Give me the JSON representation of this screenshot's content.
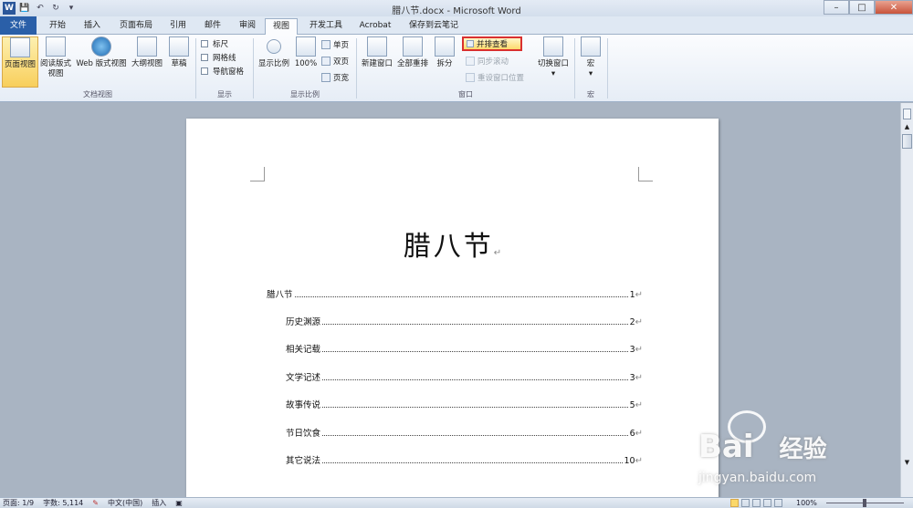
{
  "window": {
    "title": "腊八节.docx - Microsoft Word",
    "minimize": "–",
    "maximize": "□",
    "close": "✕"
  },
  "qat": {
    "save": "💾",
    "undo": "↶",
    "redo": "↻",
    "customize": "▾"
  },
  "tabs": [
    {
      "label": "文件"
    },
    {
      "label": "开始"
    },
    {
      "label": "插入"
    },
    {
      "label": "页面布局"
    },
    {
      "label": "引用"
    },
    {
      "label": "邮件"
    },
    {
      "label": "审阅"
    },
    {
      "label": "视图"
    },
    {
      "label": "开发工具"
    },
    {
      "label": "Acrobat"
    },
    {
      "label": "保存到云笔记"
    }
  ],
  "ribbon": {
    "doc_views": {
      "label": "文档视图",
      "print_layout": "页面视图",
      "full_reading_1": "阅读版式",
      "full_reading_2": "视图",
      "web_layout": "Web 版式视图",
      "outline": "大纲视图",
      "draft": "草稿"
    },
    "show": {
      "label": "显示",
      "ruler": "标尺",
      "gridlines": "网格线",
      "nav_pane": "导航窗格"
    },
    "zoom": {
      "label": "显示比例",
      "zoom": "显示比例",
      "hundred": "100%",
      "one_page": "单页",
      "two_pages": "双页",
      "page_width": "页宽"
    },
    "window": {
      "label": "窗口",
      "new_window": "新建窗口",
      "arrange_all": "全部重排",
      "split": "拆分",
      "side_by_side": "并排查看",
      "sync_scroll": "同步滚动",
      "reset_pos": "重设窗口位置",
      "switch": "切换窗口"
    },
    "macros": {
      "label": "宏",
      "macros": "宏"
    }
  },
  "document": {
    "title": "腊八节",
    "toc": [
      {
        "text": "腊八节",
        "page": "1",
        "level": 1
      },
      {
        "text": "历史渊源",
        "page": "2",
        "level": 2
      },
      {
        "text": "相关记载",
        "page": "3",
        "level": 2
      },
      {
        "text": "文学记述",
        "page": "3",
        "level": 2
      },
      {
        "text": "故事传说",
        "page": "5",
        "level": 2
      },
      {
        "text": "节日饮食",
        "page": "6",
        "level": 2
      },
      {
        "text": "其它说法",
        "page": "10",
        "level": 2
      }
    ],
    "para_mark": "↵"
  },
  "status": {
    "page": "页面: 1/9",
    "words": "字数: 5,114",
    "lang": "中文(中国)",
    "mode": "插入",
    "zoom": "100%"
  },
  "watermark": {
    "brand": "Bai",
    "brand2": "经验",
    "url": "jingyan.baidu.com"
  }
}
